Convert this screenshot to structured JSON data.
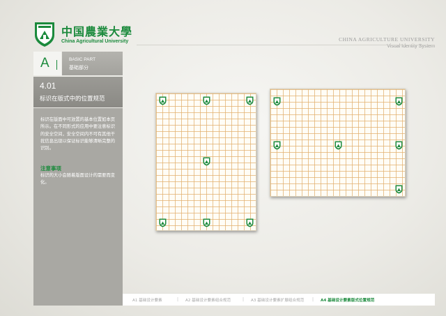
{
  "header": {
    "university_cn": "中国農業大學",
    "university_en": "China Agricultural University",
    "right_title_1": "CHINA AGRICULTURE UNIVERSITY",
    "right_title_2": "Visual Identity System"
  },
  "sidebar": {
    "section_letter": "A",
    "part_en": "BASIC PART",
    "part_cn": "基础部分",
    "section_number": "4.01",
    "section_title": "标识在版式中的位置规范",
    "body": "标识在版面中可放置的基本位置如本页所示。在不同形式的应用中要注意标识的安全空间，安全空间内不可有其他干扰信息出现以保证标识能够清晰完整的识别。",
    "note_title": "注意事项",
    "note_body": "标识的大小会随着版面设计的需要而变化。"
  },
  "footer": {
    "items": [
      "A1  基础设计要素",
      "A2  基础设计要素组合规范",
      "A3  基础设计要素扩展组合规范",
      "A4  基础设计要素版式位置规范"
    ],
    "active_index": 3
  },
  "colors": {
    "brand_green": "#1b8a3c",
    "grid_orange": "#e2b06e"
  },
  "icons": {
    "emblem": "university-shield-emblem-icon"
  }
}
